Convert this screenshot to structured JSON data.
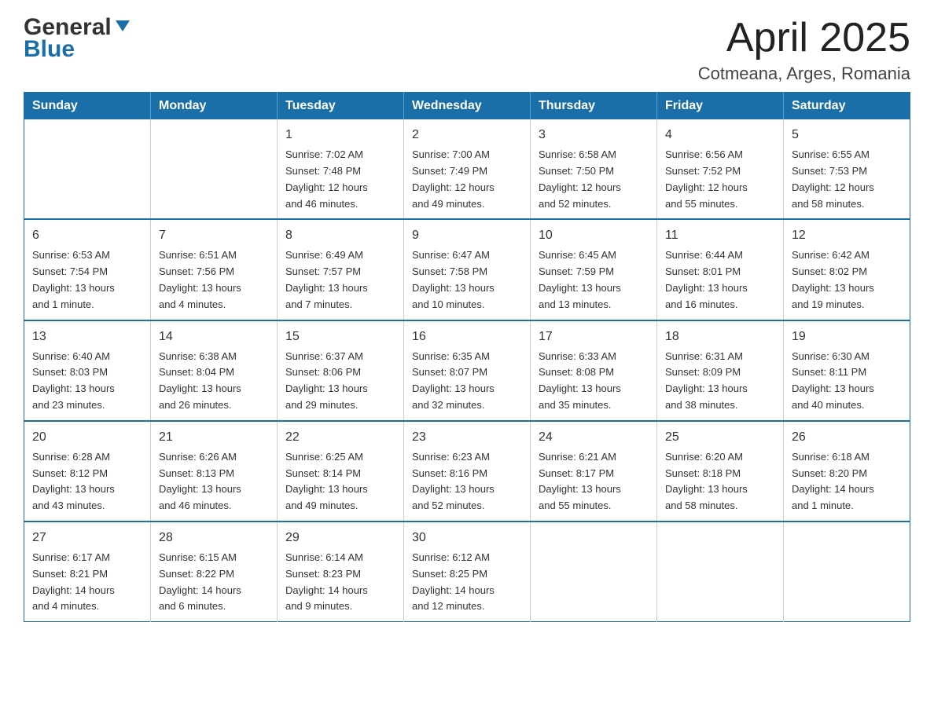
{
  "header": {
    "logo_general": "General",
    "logo_blue": "Blue",
    "title": "April 2025",
    "subtitle": "Cotmeana, Arges, Romania"
  },
  "days_of_week": [
    "Sunday",
    "Monday",
    "Tuesday",
    "Wednesday",
    "Thursday",
    "Friday",
    "Saturday"
  ],
  "weeks": [
    [
      {
        "day": "",
        "info": ""
      },
      {
        "day": "",
        "info": ""
      },
      {
        "day": "1",
        "info": "Sunrise: 7:02 AM\nSunset: 7:48 PM\nDaylight: 12 hours\nand 46 minutes."
      },
      {
        "day": "2",
        "info": "Sunrise: 7:00 AM\nSunset: 7:49 PM\nDaylight: 12 hours\nand 49 minutes."
      },
      {
        "day": "3",
        "info": "Sunrise: 6:58 AM\nSunset: 7:50 PM\nDaylight: 12 hours\nand 52 minutes."
      },
      {
        "day": "4",
        "info": "Sunrise: 6:56 AM\nSunset: 7:52 PM\nDaylight: 12 hours\nand 55 minutes."
      },
      {
        "day": "5",
        "info": "Sunrise: 6:55 AM\nSunset: 7:53 PM\nDaylight: 12 hours\nand 58 minutes."
      }
    ],
    [
      {
        "day": "6",
        "info": "Sunrise: 6:53 AM\nSunset: 7:54 PM\nDaylight: 13 hours\nand 1 minute."
      },
      {
        "day": "7",
        "info": "Sunrise: 6:51 AM\nSunset: 7:56 PM\nDaylight: 13 hours\nand 4 minutes."
      },
      {
        "day": "8",
        "info": "Sunrise: 6:49 AM\nSunset: 7:57 PM\nDaylight: 13 hours\nand 7 minutes."
      },
      {
        "day": "9",
        "info": "Sunrise: 6:47 AM\nSunset: 7:58 PM\nDaylight: 13 hours\nand 10 minutes."
      },
      {
        "day": "10",
        "info": "Sunrise: 6:45 AM\nSunset: 7:59 PM\nDaylight: 13 hours\nand 13 minutes."
      },
      {
        "day": "11",
        "info": "Sunrise: 6:44 AM\nSunset: 8:01 PM\nDaylight: 13 hours\nand 16 minutes."
      },
      {
        "day": "12",
        "info": "Sunrise: 6:42 AM\nSunset: 8:02 PM\nDaylight: 13 hours\nand 19 minutes."
      }
    ],
    [
      {
        "day": "13",
        "info": "Sunrise: 6:40 AM\nSunset: 8:03 PM\nDaylight: 13 hours\nand 23 minutes."
      },
      {
        "day": "14",
        "info": "Sunrise: 6:38 AM\nSunset: 8:04 PM\nDaylight: 13 hours\nand 26 minutes."
      },
      {
        "day": "15",
        "info": "Sunrise: 6:37 AM\nSunset: 8:06 PM\nDaylight: 13 hours\nand 29 minutes."
      },
      {
        "day": "16",
        "info": "Sunrise: 6:35 AM\nSunset: 8:07 PM\nDaylight: 13 hours\nand 32 minutes."
      },
      {
        "day": "17",
        "info": "Sunrise: 6:33 AM\nSunset: 8:08 PM\nDaylight: 13 hours\nand 35 minutes."
      },
      {
        "day": "18",
        "info": "Sunrise: 6:31 AM\nSunset: 8:09 PM\nDaylight: 13 hours\nand 38 minutes."
      },
      {
        "day": "19",
        "info": "Sunrise: 6:30 AM\nSunset: 8:11 PM\nDaylight: 13 hours\nand 40 minutes."
      }
    ],
    [
      {
        "day": "20",
        "info": "Sunrise: 6:28 AM\nSunset: 8:12 PM\nDaylight: 13 hours\nand 43 minutes."
      },
      {
        "day": "21",
        "info": "Sunrise: 6:26 AM\nSunset: 8:13 PM\nDaylight: 13 hours\nand 46 minutes."
      },
      {
        "day": "22",
        "info": "Sunrise: 6:25 AM\nSunset: 8:14 PM\nDaylight: 13 hours\nand 49 minutes."
      },
      {
        "day": "23",
        "info": "Sunrise: 6:23 AM\nSunset: 8:16 PM\nDaylight: 13 hours\nand 52 minutes."
      },
      {
        "day": "24",
        "info": "Sunrise: 6:21 AM\nSunset: 8:17 PM\nDaylight: 13 hours\nand 55 minutes."
      },
      {
        "day": "25",
        "info": "Sunrise: 6:20 AM\nSunset: 8:18 PM\nDaylight: 13 hours\nand 58 minutes."
      },
      {
        "day": "26",
        "info": "Sunrise: 6:18 AM\nSunset: 8:20 PM\nDaylight: 14 hours\nand 1 minute."
      }
    ],
    [
      {
        "day": "27",
        "info": "Sunrise: 6:17 AM\nSunset: 8:21 PM\nDaylight: 14 hours\nand 4 minutes."
      },
      {
        "day": "28",
        "info": "Sunrise: 6:15 AM\nSunset: 8:22 PM\nDaylight: 14 hours\nand 6 minutes."
      },
      {
        "day": "29",
        "info": "Sunrise: 6:14 AM\nSunset: 8:23 PM\nDaylight: 14 hours\nand 9 minutes."
      },
      {
        "day": "30",
        "info": "Sunrise: 6:12 AM\nSunset: 8:25 PM\nDaylight: 14 hours\nand 12 minutes."
      },
      {
        "day": "",
        "info": ""
      },
      {
        "day": "",
        "info": ""
      },
      {
        "day": "",
        "info": ""
      }
    ]
  ]
}
